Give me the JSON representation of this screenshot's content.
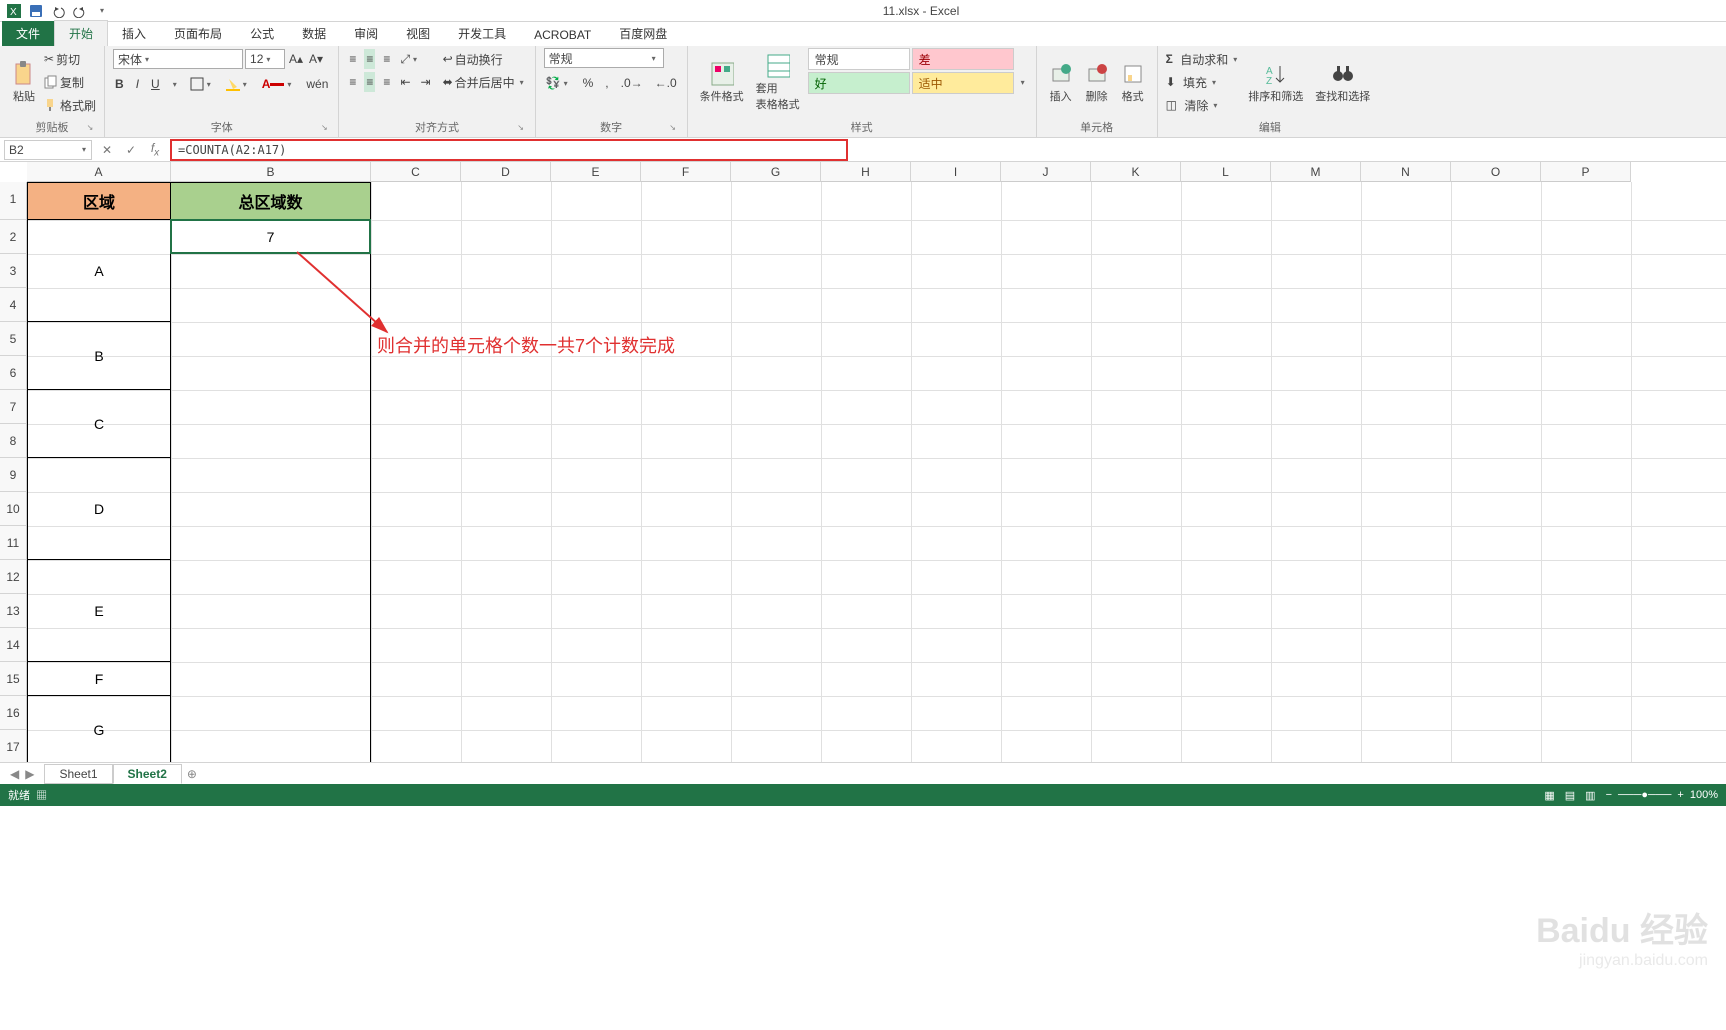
{
  "title": "11.xlsx - Excel",
  "qat": {
    "save": "保存",
    "undo": "撤销",
    "redo": "重做"
  },
  "tabs": {
    "file": "文件",
    "home": "开始",
    "insert": "插入",
    "layout": "页面布局",
    "formulas": "公式",
    "data": "数据",
    "review": "审阅",
    "view": "视图",
    "dev": "开发工具",
    "acrobat": "ACROBAT",
    "baidu": "百度网盘"
  },
  "ribbon": {
    "clipboard": {
      "label": "剪贴板",
      "paste": "粘贴",
      "cut": "剪切",
      "copy": "复制",
      "painter": "格式刷"
    },
    "font": {
      "label": "字体",
      "name": "宋体",
      "size": "12",
      "bold": "B",
      "italic": "I",
      "underline": "U"
    },
    "align": {
      "label": "对齐方式",
      "wrap": "自动换行",
      "merge": "合并后居中"
    },
    "number": {
      "label": "数字",
      "format": "常规"
    },
    "styles": {
      "label": "样式",
      "cond": "条件格式",
      "table": "套用\n表格格式",
      "normal": "常规",
      "bad": "差",
      "good": "好",
      "neutral": "适中"
    },
    "cells": {
      "label": "单元格",
      "insert": "插入",
      "delete": "删除",
      "format": "格式"
    },
    "editing": {
      "label": "编辑",
      "sum": "自动求和",
      "fill": "填充",
      "clear": "清除",
      "sort": "排序和筛选",
      "find": "查找和选择"
    }
  },
  "namebox": "B2",
  "formula": "=COUNTA(A2:A17)",
  "columns": [
    "A",
    "B",
    "C",
    "D",
    "E",
    "F",
    "G",
    "H",
    "I",
    "J",
    "K",
    "L",
    "M",
    "N",
    "O",
    "P"
  ],
  "rows": [
    "1",
    "2",
    "3",
    "4",
    "5",
    "6",
    "7",
    "8",
    "9",
    "10",
    "11",
    "12",
    "13",
    "14",
    "15",
    "16",
    "17"
  ],
  "data": {
    "A1": "区域",
    "B1": "总区域数",
    "B2": "7",
    "Amerge": [
      {
        "label": "A",
        "rows": [
          2,
          4
        ]
      },
      {
        "label": "B",
        "rows": [
          5,
          6
        ]
      },
      {
        "label": "C",
        "rows": [
          7,
          8
        ]
      },
      {
        "label": "D",
        "rows": [
          9,
          11
        ]
      },
      {
        "label": "E",
        "rows": [
          12,
          14
        ]
      },
      {
        "label": "F",
        "rows": [
          15,
          15
        ]
      },
      {
        "label": "G",
        "rows": [
          16,
          17
        ]
      }
    ]
  },
  "annotation": "则合并的单元格个数一共7个计数完成",
  "sheets": {
    "s1": "Sheet1",
    "s2": "Sheet2"
  },
  "status": {
    "ready": "就绪",
    "zoom": "100%"
  },
  "watermark": {
    "logo": "Baidu 经验",
    "url": "jingyan.baidu.com"
  }
}
